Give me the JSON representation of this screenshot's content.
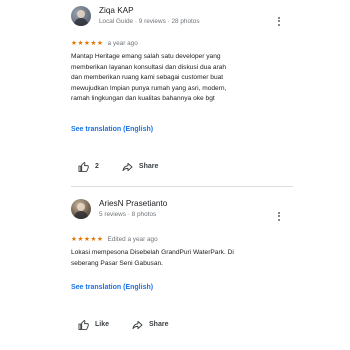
{
  "reviews": [
    {
      "author": "Ziqa KAP",
      "meta": "Local Guide · 9 reviews · 28 photos",
      "stars": "★★★★★",
      "time": "a year ago",
      "text_lines": [
        "Mantap Heritage emang salah satu developer yang",
        "memberikan layanan konsultasi dan diskusi dua arah",
        "dan memberikan ruang kami sebagai customer buat",
        "mewujudkan Impian punya rumah yang asri, modern,",
        "ramah lingkungan dan kualitas bahannya oke bgt"
      ],
      "translation_link": "See translation (English)",
      "like_label": "2",
      "share_label": "Share"
    },
    {
      "author": "AriesN Prasetianto",
      "meta": "5 reviews · 8 photos",
      "stars": "★★★★★",
      "time": "Edited a year ago",
      "text_lines": [
        "Lokasi mempesona Disebelah GrandPuri WaterPark. Di",
        "seberang Pasar Seni Gabusan."
      ],
      "translation_link": "See translation (English)",
      "like_label": "Like",
      "share_label": "Share"
    }
  ],
  "icons": {
    "like": "thumbs-up-icon",
    "share": "share-icon",
    "menu": "more-vert-icon"
  },
  "colors": {
    "star": "#e37400",
    "link": "#1a73e8",
    "secondary_text": "#70757a"
  }
}
